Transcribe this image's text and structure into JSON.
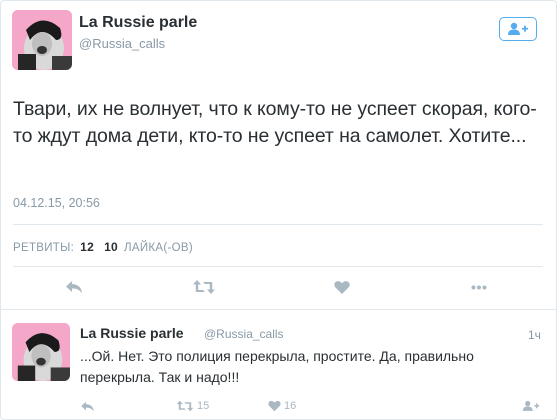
{
  "tweet": {
    "author_name": "La Russie parle",
    "author_handle": "@Russia_calls",
    "text": "Твари, их не волнует, что к кому-то не успеет скорая, кого-то ждут дома дети, кто-то не успеет на самолет. Хотите...",
    "timestamp": "04.12.15, 20:56",
    "retweets_label": "РЕТВИТЫ:",
    "retweets_count": "12",
    "likes_count": "10",
    "likes_label": "ЛАЙКА(-ОВ)",
    "actions": [
      "reply-icon",
      "retweet-icon",
      "heart-icon",
      "more-icon"
    ]
  },
  "reply": {
    "author_name": "La Russie parle",
    "author_handle": "@Russia_calls",
    "time": "1ч",
    "text": "...Ой. Нет. Это полиция перекрыла, простите. Да, правильно перекрыла. Так и надо!!!",
    "retweet_count": "15",
    "like_count": "16"
  },
  "colors": {
    "accent": "#55acee",
    "muted": "#8899a6",
    "icon": "#aab8c2",
    "text": "#292f33",
    "avatar_bg": "#f4a7c9"
  }
}
